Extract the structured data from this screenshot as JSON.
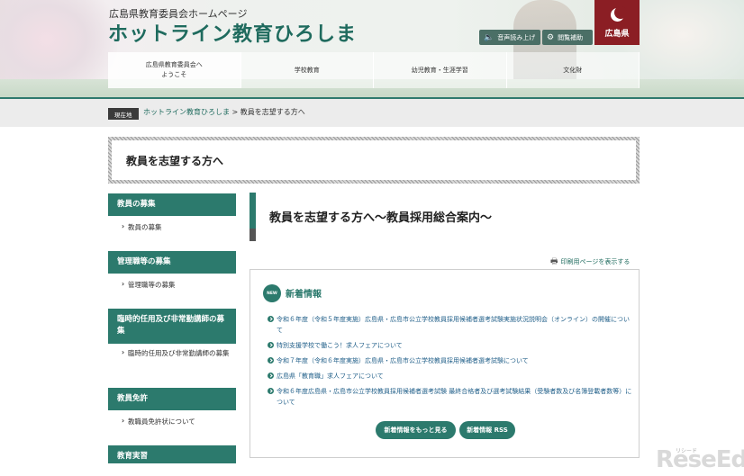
{
  "header": {
    "subtitle": "広島県教育委員会ホームページ",
    "title": "ホットライン教育ひろしま",
    "tools": {
      "voice_label": "音声読み上げ",
      "voice_icon": "speaker-icon",
      "assist_label": "閲覧補助",
      "assist_icon": "gear-icon"
    },
    "badge_label": "広島県",
    "nav": [
      "広島県教育委員会へ\nようこそ",
      "学校教育",
      "幼児教育・生涯学習",
      "文化財"
    ]
  },
  "breadcrumb": {
    "tag": "現在地",
    "home": "ホットライン教育ひろしま",
    "separator": " > ",
    "current": "教員を志望する方へ"
  },
  "page_title": "教員を志望する方へ",
  "sidebar": [
    {
      "heading": "教員の募集",
      "link": "教員の募集"
    },
    {
      "heading": "管理職等の募集",
      "link": "管理職等の募集"
    },
    {
      "heading": "臨時的任用及び非常勤講師の募集",
      "link": "臨時的任用及び非常勤講師の募集"
    },
    {
      "heading": "教員免許",
      "link": "教職員免許状について"
    },
    {
      "heading": "教育実習",
      "link": ""
    }
  ],
  "main": {
    "heading": "教員を志望する方へ～教員採用総合案内～",
    "print_label": "印刷用ページを表示する",
    "news_badge": "NEW",
    "news_title": "新着情報",
    "news": [
      "令和６年度（令和５年度実施）広島県・広島市公立学校教員採用候補者選考試験実施状況説明会（オンライン）の開催について",
      "特別支援学校で働こう！求人フェアについて",
      "令和７年度（令和６年度実施）広島県・広島市公立学校教員採用候補者選考試験について",
      "広島県「教育職」求人フェアについて",
      "令和６年度広島県・広島市公立学校教員採用候補者選考試験 最終合格者及び選考試験結果（受験者数及び名簿登載者数等）について"
    ],
    "more_label": "新着情報をもっと見る",
    "rss_label": "新着情報 RSS"
  },
  "watermark": {
    "text": "ReseEd",
    "small": "リシード"
  },
  "colors": {
    "accent": "#2c7a6d",
    "badge": "#8b1e24",
    "link": "#1f5e88"
  }
}
